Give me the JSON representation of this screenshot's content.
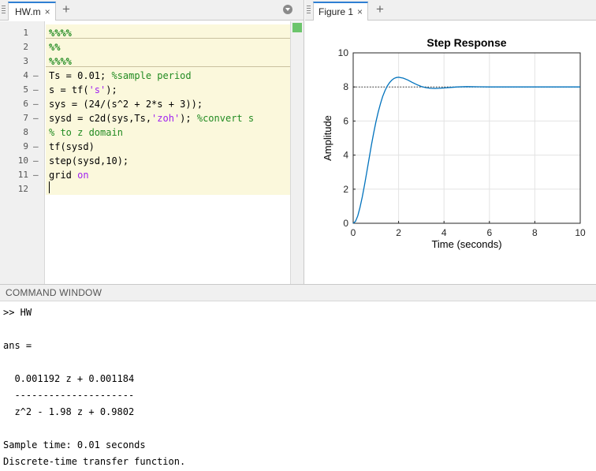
{
  "editor": {
    "tab_label": "HW.m",
    "close_glyph": "×",
    "add_glyph": "+",
    "line_numbers": [
      "1",
      "2",
      "3",
      "4",
      "5",
      "6",
      "7",
      "8",
      "9",
      "10",
      "11",
      "12"
    ],
    "exec_markers": [
      "",
      "",
      "",
      "–",
      "–",
      "–",
      "–",
      "",
      "–",
      "–",
      "–",
      ""
    ],
    "lines": [
      [
        {
          "t": "%%%%",
          "k": "comment bold"
        }
      ],
      [
        {
          "t": "%%",
          "k": "comment bold"
        }
      ],
      [
        {
          "t": "%%%%",
          "k": "comment bold"
        }
      ],
      [
        {
          "t": "Ts = 0.01; ",
          "k": ""
        },
        {
          "t": "%sample period",
          "k": "comment"
        }
      ],
      [
        {
          "t": "s = tf(",
          "k": ""
        },
        {
          "t": "'s'",
          "k": "string"
        },
        {
          "t": ");",
          "k": ""
        }
      ],
      [
        {
          "t": "sys = (24/(s^2 + 2*s + 3));",
          "k": ""
        }
      ],
      [
        {
          "t": "sysd = c2d(sys,Ts,",
          "k": ""
        },
        {
          "t": "'zoh'",
          "k": "string"
        },
        {
          "t": "); ",
          "k": ""
        },
        {
          "t": "%convert s",
          "k": "comment"
        }
      ],
      [
        {
          "t": "% to z domain",
          "k": "comment"
        }
      ],
      [
        {
          "t": "tf(sysd)",
          "k": ""
        }
      ],
      [
        {
          "t": "step(sysd,10);",
          "k": ""
        }
      ],
      [
        {
          "t": "grid ",
          "k": ""
        },
        {
          "t": "on",
          "k": "string"
        }
      ],
      []
    ],
    "status_color": "#6cc56c"
  },
  "figure": {
    "tab_label": "Figure 1",
    "close_glyph": "×",
    "add_glyph": "+"
  },
  "chart_data": {
    "type": "line",
    "title": "Step Response",
    "xlabel": "Time (seconds)",
    "ylabel": "Amplitude",
    "xlim": [
      0,
      10
    ],
    "ylim": [
      0,
      10
    ],
    "xticks": [
      0,
      2,
      4,
      6,
      8,
      10
    ],
    "yticks": [
      0,
      2,
      4,
      6,
      8,
      10
    ],
    "grid": true,
    "steady_state_line": 8,
    "line_color": "#0072bd",
    "series": [
      {
        "x": [
          0,
          0.1,
          0.2,
          0.3,
          0.4,
          0.5,
          0.6,
          0.7,
          0.8,
          0.9,
          1.0,
          1.1,
          1.2,
          1.3,
          1.4,
          1.5,
          1.6,
          1.7,
          1.8,
          1.9,
          2.0,
          2.2,
          2.4,
          2.6,
          2.8,
          3.0,
          3.2,
          3.4,
          3.6,
          3.8,
          4.0,
          4.3,
          4.6,
          5.0,
          5.5,
          6.0,
          6.5,
          7.0,
          8.0,
          9.0,
          10.0
        ],
        "y": [
          0,
          0.11,
          0.43,
          0.92,
          1.54,
          2.25,
          3.02,
          3.8,
          4.56,
          5.28,
          5.94,
          6.52,
          7.02,
          7.44,
          7.78,
          8.05,
          8.25,
          8.4,
          8.5,
          8.55,
          8.57,
          8.52,
          8.41,
          8.27,
          8.14,
          8.03,
          7.96,
          7.92,
          7.91,
          7.92,
          7.94,
          7.97,
          8.0,
          8.02,
          8.01,
          8.0,
          8.0,
          8.0,
          8.0,
          8.0,
          8.0
        ]
      }
    ]
  },
  "command_window": {
    "header": "COMMAND WINDOW",
    "lines": [
      ">> HW",
      "",
      "ans =",
      "",
      "  0.001192 z + 0.001184",
      "  ---------------------",
      "  z^2 - 1.98 z + 0.9802",
      "",
      "Sample time: 0.01 seconds",
      "Discrete-time transfer function."
    ]
  }
}
